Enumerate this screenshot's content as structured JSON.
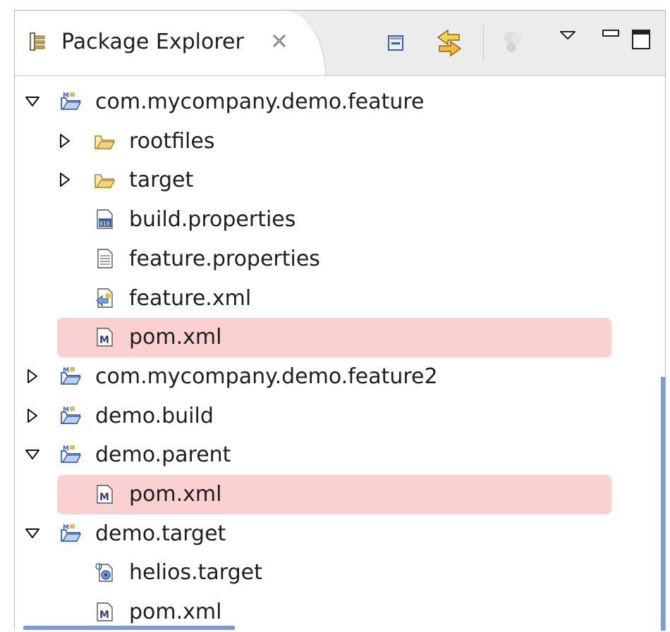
{
  "view": {
    "title": "Package Explorer",
    "icons": {
      "view": "package-explorer-icon",
      "close": "close-tab-icon",
      "collapse": "collapse-all-icon",
      "link": "link-with-editor-icon",
      "focus": "focus-task-icon",
      "menu": "view-menu-icon",
      "minimize": "minimize-icon",
      "maximize": "maximize-icon"
    }
  },
  "tree": [
    {
      "label": "com.mycompany.demo.feature",
      "level": 0,
      "state": "expanded",
      "icon": "maven-project-icon"
    },
    {
      "label": "rootfiles",
      "level": 1,
      "state": "collapsed",
      "icon": "folder-icon"
    },
    {
      "label": "target",
      "level": 1,
      "state": "collapsed",
      "icon": "folder-icon"
    },
    {
      "label": "build.properties",
      "level": 1,
      "state": "leaf",
      "icon": "properties-file-icon"
    },
    {
      "label": "feature.properties",
      "level": 1,
      "state": "leaf",
      "icon": "text-file-icon"
    },
    {
      "label": "feature.xml",
      "level": 1,
      "state": "leaf",
      "icon": "feature-file-icon"
    },
    {
      "label": "pom.xml",
      "level": 1,
      "state": "leaf",
      "icon": "pom-file-icon",
      "highlighted": true
    },
    {
      "label": "com.mycompany.demo.feature2",
      "level": 0,
      "state": "collapsed",
      "icon": "maven-project-icon"
    },
    {
      "label": "demo.build",
      "level": 0,
      "state": "collapsed",
      "icon": "maven-project-icon"
    },
    {
      "label": "demo.parent",
      "level": 0,
      "state": "expanded",
      "icon": "maven-project-icon"
    },
    {
      "label": "pom.xml",
      "level": 1,
      "state": "leaf",
      "icon": "pom-file-icon",
      "highlighted": true
    },
    {
      "label": "demo.target",
      "level": 0,
      "state": "expanded",
      "icon": "maven-project-icon"
    },
    {
      "label": "helios.target",
      "level": 1,
      "state": "leaf",
      "icon": "target-file-icon"
    },
    {
      "label": "pom.xml",
      "level": 1,
      "state": "leaf",
      "icon": "pom-file-icon"
    }
  ],
  "colors": {
    "highlight": "#fbd0d0",
    "text": "#1e1e1e",
    "scrollbar": "#7a9ad8"
  }
}
